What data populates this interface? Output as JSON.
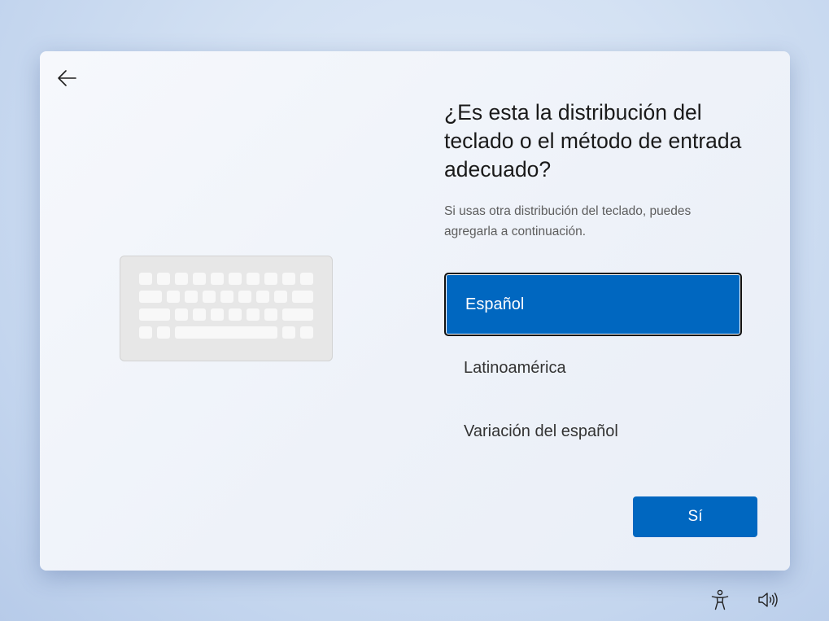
{
  "dialog": {
    "back_icon": "arrow-left-icon",
    "illustration": "keyboard-illustration",
    "title": "¿Es esta la distribución del teclado o el método de entrada adecuado?",
    "subtitle": "Si usas otra distribución del teclado, puedes agregarla a continuación.",
    "layouts": [
      {
        "label": "Español",
        "selected": true
      },
      {
        "label": "Latinoamérica",
        "selected": false
      },
      {
        "label": "Variación del español",
        "selected": false
      }
    ],
    "confirm_label": "Sí"
  },
  "taskbar": {
    "accessibility_icon": "accessibility-icon",
    "volume_icon": "speaker-volume-icon"
  },
  "colors": {
    "accent": "#0067c0",
    "card_background": "#f3f6fb",
    "desktop_background": "#cfdff3"
  }
}
